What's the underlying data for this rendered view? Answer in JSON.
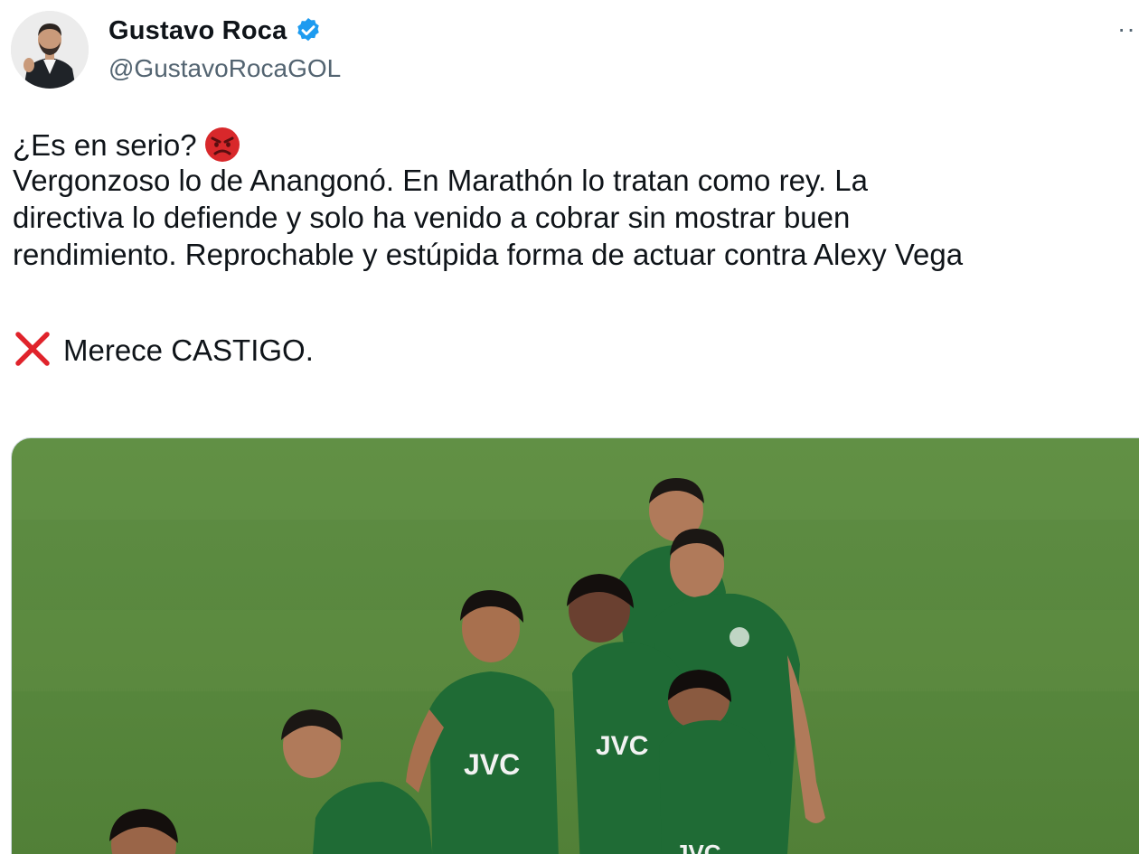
{
  "author": {
    "display_name": "Gustavo Roca",
    "handle": "@GustavoRocaGOL",
    "verified": true,
    "verified_color": "#1d9bf0"
  },
  "tweet": {
    "lines": [
      "¿Es en serio?",
      "Vergonzoso lo de Anangonó. En Marathón lo tratan como rey. La",
      "directiva lo defiende y solo ha venido a cobrar sin mostrar buen",
      "rendimiento. Reprochable y estúpida forma de actuar contra Alexy Vega",
      "Merece CASTIGO."
    ],
    "emoji_after_first_line": "angry-face-icon",
    "emoji_before_last_line": "cross-mark-icon"
  },
  "media": {
    "jersey_texts": [
      "JVC",
      "JVC",
      "JVC"
    ]
  },
  "icons": {
    "more": "more-options-icon"
  },
  "colors": {
    "text": "#0f1419",
    "secondary": "#536471",
    "pitch": "#5c8a3c",
    "jersey": "#1f6b35"
  }
}
